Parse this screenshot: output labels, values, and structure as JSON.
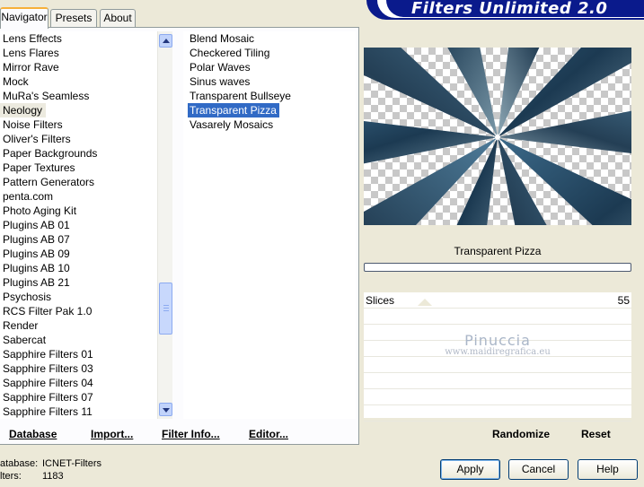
{
  "banner": {
    "title": "Filters Unlimited 2.0"
  },
  "tabs": [
    "Navigator",
    "Presets",
    "About"
  ],
  "categories": {
    "items": [
      "Lens Effects",
      "Lens Flares",
      "Mirror Rave",
      "Mock",
      "MuRa's Seamless",
      "Neology",
      "Noise Filters",
      "Oliver's Filters",
      "Paper Backgrounds",
      "Paper Textures",
      "Pattern Generators",
      "penta.com",
      "Photo Aging Kit",
      "Plugins AB 01",
      "Plugins AB 07",
      "Plugins AB 09",
      "Plugins AB 10",
      "Plugins AB 21",
      "Psychosis",
      "RCS Filter Pak 1.0",
      "Render",
      "Sabercat",
      "Sapphire Filters 01",
      "Sapphire Filters 03",
      "Sapphire Filters 04",
      "Sapphire Filters 07",
      "Sapphire Filters 11"
    ],
    "selected": "Neology"
  },
  "filters": {
    "items": [
      "Blend Mosaic",
      "Checkered Tiling",
      "Polar Waves",
      "Sinus waves",
      "Transparent Bullseye",
      "Transparent Pizza",
      "Vasarely Mosaics"
    ],
    "selected": "Transparent Pizza"
  },
  "left_buttons": {
    "database": "Database",
    "import": "Import...",
    "filter_info": "Filter Info...",
    "editor": "Editor..."
  },
  "preview": {
    "filter_name": "Transparent Pizza"
  },
  "params": [
    {
      "label": "Slices",
      "value": "55"
    }
  ],
  "watermark": {
    "name": "Pinuccia",
    "url": "www.maidiregrafica.eu"
  },
  "right_buttons": {
    "randomize": "Randomize",
    "reset": "Reset"
  },
  "status": {
    "database_label": "atabase:",
    "database_value": "ICNET-Filters",
    "filters_label": "lters:",
    "filters_value": "1183"
  },
  "dialog_buttons": {
    "apply": "Apply",
    "cancel": "Cancel",
    "help": "Help"
  },
  "colors": {
    "accent": "#316ac5",
    "banner": "#0a1a8c",
    "tab_highlight": "#f7b03a"
  }
}
